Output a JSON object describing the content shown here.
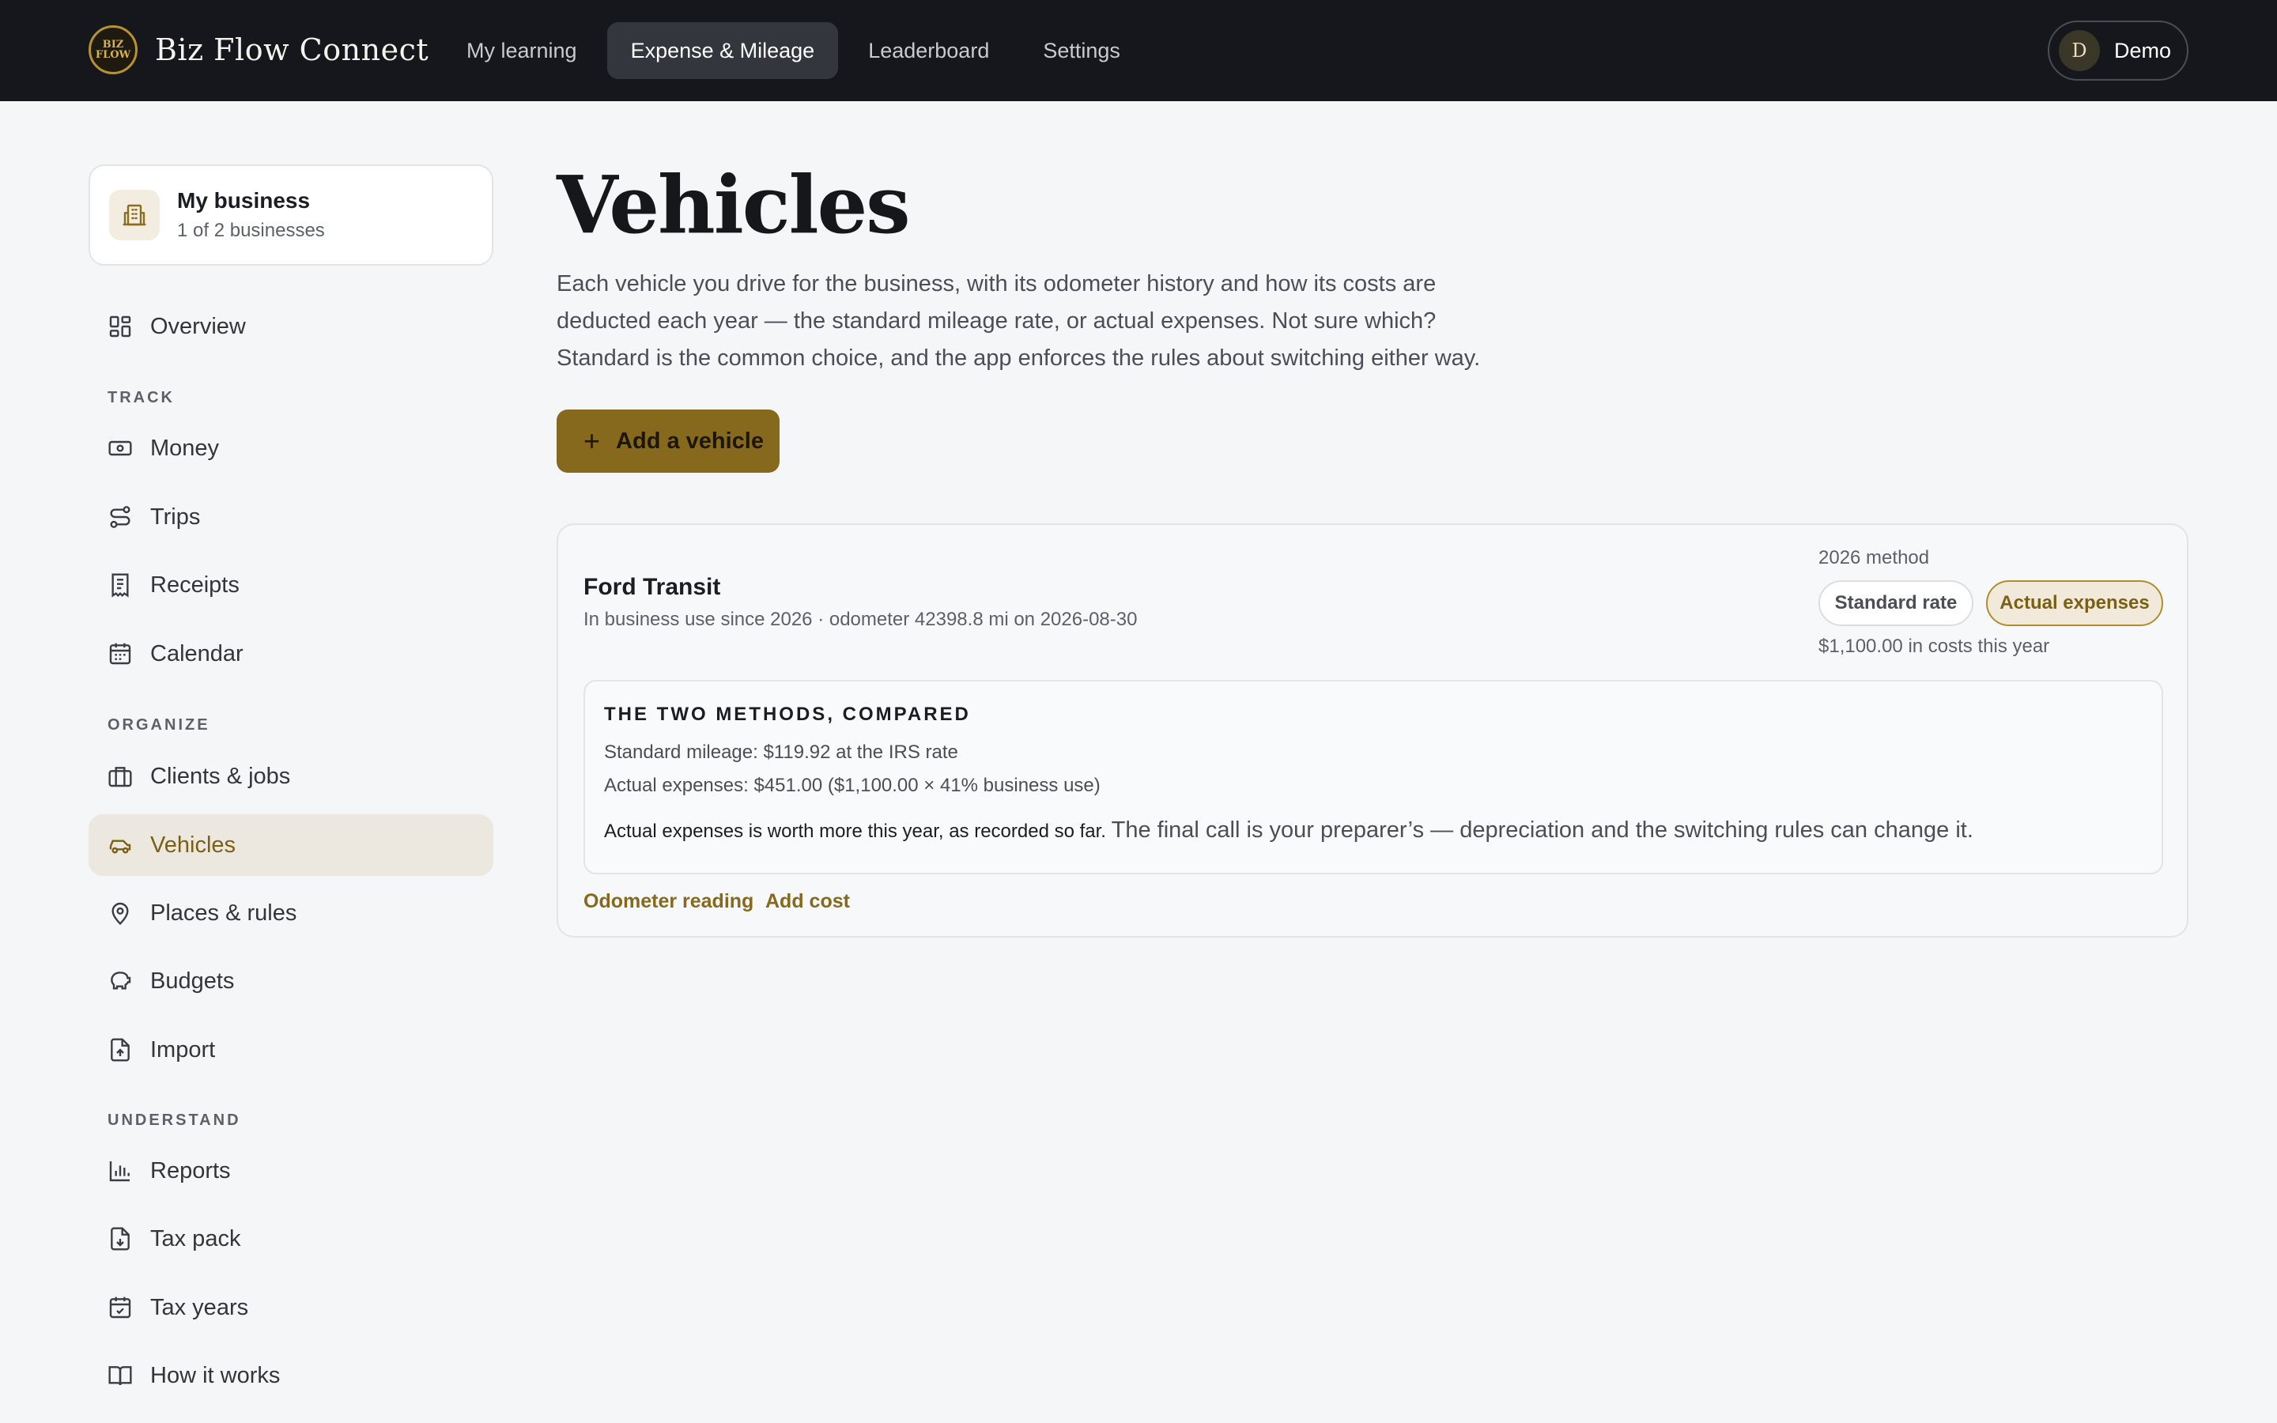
{
  "brand": {
    "logo_line1": "BIZ",
    "logo_line2": "FLOW",
    "name": "Biz Flow Connect"
  },
  "nav": [
    {
      "label": "My learning"
    },
    {
      "label": "Expense & Mileage",
      "active": true
    },
    {
      "label": "Leaderboard"
    },
    {
      "label": "Settings"
    }
  ],
  "user": {
    "initial": "D",
    "name": "Demo"
  },
  "business": {
    "title": "My business",
    "subtitle": "1 of 2 businesses"
  },
  "sidebar": {
    "overview": "Overview",
    "sections": {
      "track": "TRACK",
      "organize": "ORGANIZE",
      "understand": "UNDERSTAND"
    },
    "items": {
      "money": "Money",
      "trips": "Trips",
      "receipts": "Receipts",
      "calendar": "Calendar",
      "clients": "Clients & jobs",
      "vehicles": "Vehicles",
      "places": "Places & rules",
      "budgets": "Budgets",
      "import": "Import",
      "reports": "Reports",
      "taxpack": "Tax pack",
      "taxyears": "Tax years",
      "howitworks": "How it works"
    },
    "active": "vehicles"
  },
  "main": {
    "title": "Vehicles",
    "intro": "Each vehicle you drive for the business, with its odometer history and how its costs are deducted each year — the standard mileage rate, or actual expenses. Not sure which? Standard is the common choice, and the app enforces the rules about switching either way.",
    "add_button": "Add a vehicle",
    "add_icon": "+"
  },
  "vehicle": {
    "name": "Ford Transit",
    "meta": "In business use since 2026 · odometer 42398.8 mi on 2026-08-30",
    "method_label": "2026 method",
    "method_standard": "Standard rate",
    "method_actual": "Actual expenses",
    "selected_method": "Actual expenses",
    "costs_line": "$1,100.00 in costs this year",
    "compare_heading": "THE TWO METHODS, COMPARED",
    "standard_line": "Standard mileage: $119.92 at the IRS rate",
    "actual_line": "Actual expenses: $451.00 ($1,100.00 × 41% business use)",
    "verdict_bold": "Actual expenses is worth more this year, as recorded so far.",
    "verdict_rest": "The final call is your preparer’s — depreciation and the switching rules can change it.",
    "link_odometer": "Odometer reading",
    "link_add_cost": "Add cost"
  },
  "colors": {
    "accent": "#86691c",
    "topbar": "#15171c",
    "active_bg": "#ece8df"
  }
}
